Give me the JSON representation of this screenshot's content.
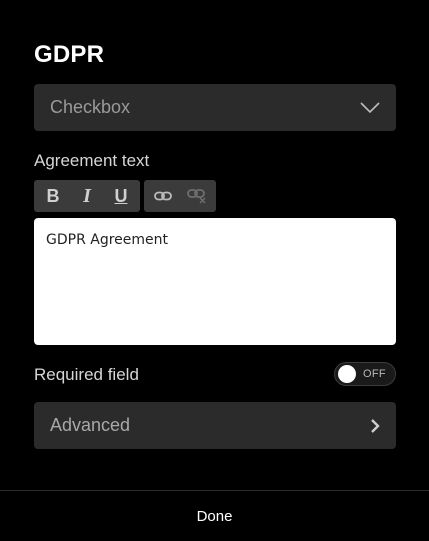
{
  "panel": {
    "title": "GDPR"
  },
  "field_type": {
    "selected": "Checkbox",
    "icon": "chevron-down-icon"
  },
  "agreement": {
    "label": "Agreement text",
    "toolbar": {
      "bold": "B",
      "italic": "I",
      "underline": "U",
      "link_icon": "link-icon",
      "unlink_icon": "unlink-icon"
    },
    "text": "GDPR Agreement"
  },
  "required": {
    "label": "Required field",
    "toggle_text": "OFF",
    "value": false
  },
  "advanced": {
    "label": "Advanced",
    "icon": "chevron-right-icon"
  },
  "footer": {
    "done_label": "Done"
  },
  "colors": {
    "background": "#000000",
    "surface": "#2b2b2b",
    "toolbar": "#3b3b3b",
    "editor": "#ffffff",
    "text": "#ffffff",
    "muted": "#9a9a9a"
  }
}
